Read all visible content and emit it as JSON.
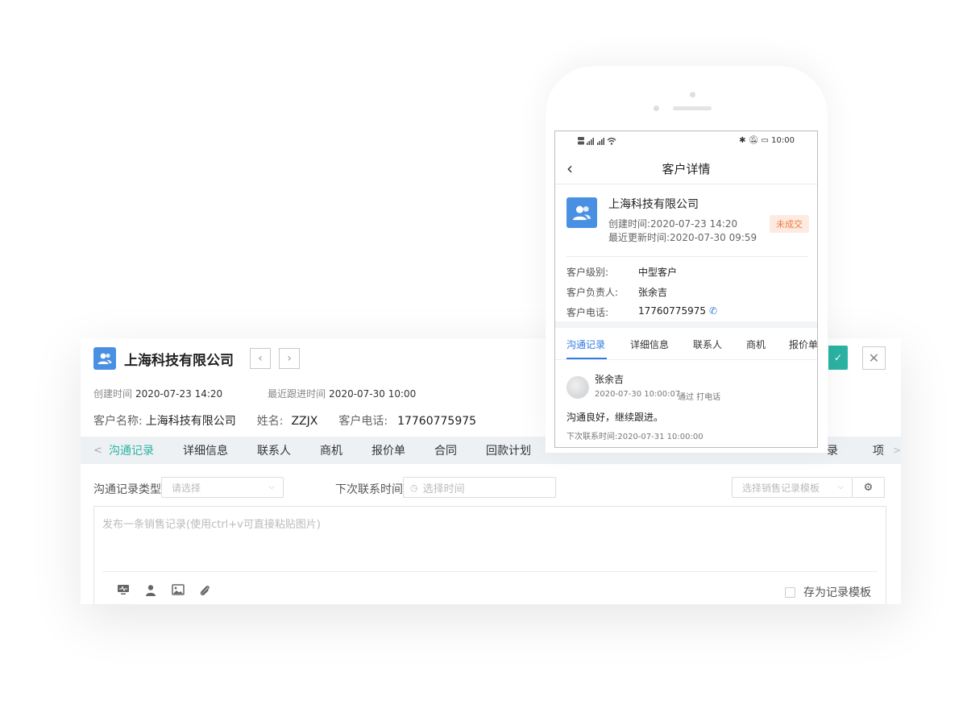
{
  "desktop": {
    "company": "上海科技有限公司",
    "nav_prev": "‹",
    "nav_next": "›",
    "meta": {
      "created_label": "创建时间",
      "created_value": "2020-07-23 14:20",
      "followup_label": "最近跟进时间",
      "followup_value": "2020-07-30 10:00"
    },
    "info": {
      "customer_label": "客户名称:",
      "customer_value": "上海科技有限公司",
      "name_label": "姓名:",
      "name_value": "ZZJX",
      "phone_label": "客户电话:",
      "phone_value": "17760775975"
    },
    "tabs": [
      "沟通记录",
      "详细信息",
      "联系人",
      "商机",
      "报价单",
      "合同",
      "回款计划"
    ],
    "tabs_tail": [
      "录",
      "项"
    ],
    "form": {
      "type_label": "沟通记录类型",
      "type_placeholder": "请选择",
      "next_label": "下次联系时间",
      "next_placeholder": "选择时间",
      "template_placeholder": "选择销售记录模板"
    },
    "editor_placeholder": "发布一条销售记录(使用ctrl+v可直接粘贴图片)",
    "save_template_label": "存为记录模板",
    "close_label": "✕",
    "confirm_label": "✓"
  },
  "mobile": {
    "status_left": "HD ᵍᵢₗ HD ᵍᵢₗ 2.4",
    "status_time": "10:00",
    "title": "客户详情",
    "company": "上海科技有限公司",
    "created": "创建时间:2020-07-23 14:20",
    "updated": "最近更新时间:2020-07-30 09:59",
    "badge": "未成交",
    "fields": [
      {
        "label": "客户级别:",
        "value": "中型客户"
      },
      {
        "label": "客户负责人:",
        "value": "张余吉"
      },
      {
        "label": "客户电话:",
        "value": "17760775975"
      }
    ],
    "tabs": [
      "沟通记录",
      "详细信息",
      "联系人",
      "商机",
      "报价单"
    ],
    "record": {
      "name": "张余吉",
      "time": "2020-07-30 10:00:07",
      "via": "通过 打电话",
      "body": "沟通良好，继续跟进。",
      "next": "下次联系时间:2020-07-31 10:00:00"
    }
  }
}
